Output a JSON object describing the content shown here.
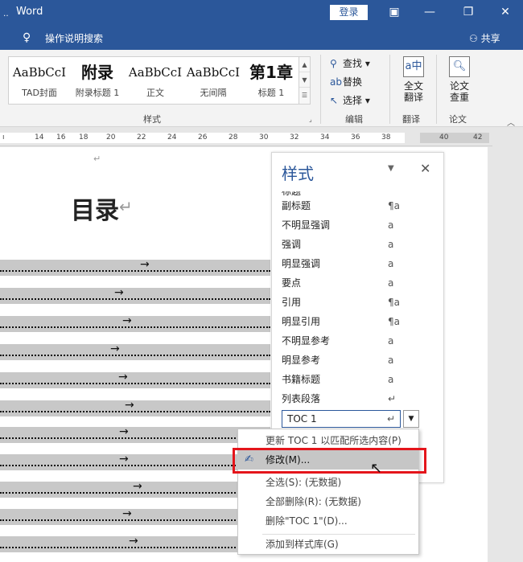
{
  "window": {
    "title": "Word",
    "login_label": "登录",
    "tell_me": "操作说明搜索",
    "share_label": "共享"
  },
  "ribbon": {
    "styles": [
      {
        "preview": "AaBbCcI",
        "name": "TAD封面"
      },
      {
        "preview": "附录",
        "name": "附录标题 1"
      },
      {
        "preview": "AaBbCcI",
        "name": "正文"
      },
      {
        "preview": "AaBbCcI",
        "name": "无间隔"
      },
      {
        "preview": "第1章",
        "name": "标题 1"
      }
    ],
    "styles_group": "样式",
    "edit": {
      "find": "查找",
      "replace": "替换",
      "select": "选择",
      "group": "编辑"
    },
    "translate": {
      "line1": "全文",
      "line2": "翻译",
      "group": "翻译"
    },
    "paper": {
      "line1": "论文",
      "line2": "查重",
      "group": "论文"
    }
  },
  "ruler": [
    "14",
    "16",
    "18",
    "20",
    "22",
    "24",
    "26",
    "28",
    "30",
    "32",
    "34",
    "36",
    "38",
    "40",
    "42"
  ],
  "document": {
    "para_mark": "↵",
    "title": "目录",
    "title_mark": "↵",
    "tab_arrow": "→"
  },
  "styles_pane": {
    "title": "样式",
    "items": [
      {
        "name": "副标题",
        "mark": "¶a"
      },
      {
        "name": "不明显强调",
        "mark": "a"
      },
      {
        "name": "强调",
        "mark": "a"
      },
      {
        "name": "明显强调",
        "mark": "a"
      },
      {
        "name": "要点",
        "mark": "a"
      },
      {
        "name": "引用",
        "mark": "¶a"
      },
      {
        "name": "明显引用",
        "mark": "¶a"
      },
      {
        "name": "不明显参考",
        "mark": "a"
      },
      {
        "name": "明显参考",
        "mark": "a"
      },
      {
        "name": "书籍标题",
        "mark": "a"
      },
      {
        "name": "列表段落",
        "mark": "↵"
      }
    ],
    "selected": "TOC 1",
    "selected_mark": "↵"
  },
  "context_menu": {
    "items": [
      "更新 TOC 1 以匹配所选内容(P)",
      "修改(M)...",
      "全选(S): (无数据)",
      "全部删除(R): (无数据)",
      "删除\"TOC 1\"(D)...",
      "添加到样式库(G)"
    ],
    "highlighted_index": 1
  },
  "colors": {
    "accent": "#2b579a",
    "highlight_border": "#e4151b"
  }
}
